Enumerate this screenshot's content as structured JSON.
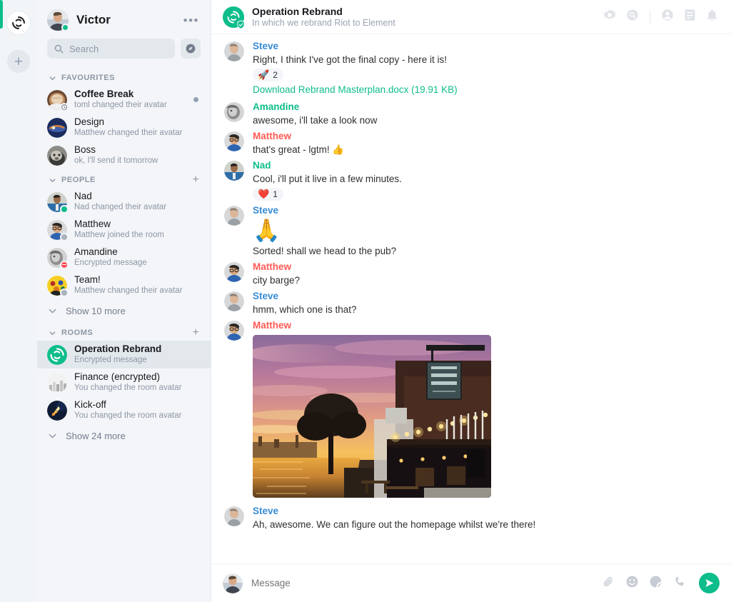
{
  "rail": {
    "home_icon": "element-logo-icon",
    "add_space_label": "+"
  },
  "sidebar": {
    "user": {
      "name": "Victor",
      "presence": "online"
    },
    "options_label": "•••",
    "search": {
      "placeholder": "Search",
      "icon": "search-icon"
    },
    "explore_icon": "compass-icon",
    "sections": [
      {
        "id": "favourites",
        "title": "FAVOURITES",
        "has_add": false,
        "items": [
          {
            "name": "Coffee Break",
            "subtitle": "toml changed their avatar",
            "unread": true,
            "bold": true,
            "badge": "clock",
            "avatar": "coffee"
          },
          {
            "name": "Design",
            "subtitle": "Matthew changed their avatar",
            "unread": false,
            "bold": false,
            "badge": "none",
            "avatar": "design"
          },
          {
            "name": "Boss",
            "subtitle": "ok, I'll send it tomorrow",
            "unread": false,
            "bold": false,
            "badge": "none",
            "avatar": "boss"
          }
        ],
        "show_more": null
      },
      {
        "id": "people",
        "title": "PEOPLE",
        "has_add": true,
        "add_label": "+",
        "items": [
          {
            "name": "Nad",
            "subtitle": "Nad changed their avatar",
            "unread": false,
            "bold": false,
            "badge": "online",
            "avatar": "nad"
          },
          {
            "name": "Matthew",
            "subtitle": "Matthew joined the room",
            "unread": false,
            "bold": false,
            "badge": "offline",
            "avatar": "matthew"
          },
          {
            "name": "Amandine",
            "subtitle": "Encrypted message",
            "unread": false,
            "bold": false,
            "badge": "dnd",
            "avatar": "amandine"
          },
          {
            "name": "Team!",
            "subtitle": "Matthew changed their avatar",
            "unread": false,
            "bold": false,
            "badge": "offline",
            "avatar": "team"
          }
        ],
        "show_more": "Show 10 more"
      },
      {
        "id": "rooms",
        "title": "ROOMS",
        "has_add": true,
        "add_label": "+",
        "items": [
          {
            "name": "Operation Rebrand",
            "subtitle": "Encrypted message",
            "unread": false,
            "bold": true,
            "badge": "none",
            "avatar": "rebrand",
            "selected": true
          },
          {
            "name": "Finance (encrypted)",
            "subtitle": "You changed the room avatar",
            "unread": false,
            "bold": false,
            "badge": "none",
            "avatar": "finance"
          },
          {
            "name": "Kick-off",
            "subtitle": "You changed the room avatar",
            "unread": false,
            "bold": false,
            "badge": "none",
            "avatar": "kickoff"
          }
        ],
        "show_more": "Show 24 more"
      }
    ]
  },
  "room_header": {
    "title": "Operation Rebrand",
    "topic": "In which we rebrand Riot to Element",
    "avatar_icon": "element-logo-icon",
    "encryption_badge": "shield-verified-icon",
    "actions": [
      {
        "name": "room-settings-button",
        "icon": "gear-icon"
      },
      {
        "name": "search-room-button",
        "icon": "search-circle-icon"
      },
      {
        "name": "member-list-button",
        "icon": "person-icon"
      },
      {
        "name": "room-info-button",
        "icon": "notes-icon"
      },
      {
        "name": "notifications-button",
        "icon": "bell-icon"
      }
    ]
  },
  "timeline": {
    "events": [
      {
        "sender": "Steve",
        "sender_class": "steve",
        "avatar": "steve",
        "text": "Right, I think I've got the final copy - here it is!",
        "reaction": {
          "emoji": "🚀",
          "count": "2"
        },
        "link": "Download Rebrand Masterplan.docx (19.91 KB)"
      },
      {
        "sender": "Amandine",
        "sender_class": "amandine",
        "avatar": "amandine",
        "text": "awesome, i'll take a look now"
      },
      {
        "sender": "Matthew",
        "sender_class": "matthew",
        "avatar": "matthew",
        "text": "that's great - lgtm! 👍"
      },
      {
        "sender": "Nad",
        "sender_class": "nad",
        "avatar": "nad",
        "text": "Cool, i'll put it live in a few minutes.",
        "reaction": {
          "emoji": "❤️",
          "count": "1"
        }
      },
      {
        "sender": "Steve",
        "sender_class": "steve",
        "avatar": "steve",
        "big_emoji": "🙏",
        "text": "Sorted! shall we head to the pub?"
      },
      {
        "sender": "Matthew",
        "sender_class": "matthew",
        "avatar": "matthew",
        "text": "city barge?"
      },
      {
        "sender": "Steve",
        "sender_class": "steve",
        "avatar": "steve",
        "text": "hmm, which one is that?"
      },
      {
        "sender": "Matthew",
        "sender_class": "matthew",
        "avatar": "matthew",
        "image": "sunset-riverside-pub-the-city-barge"
      },
      {
        "sender": "Steve",
        "sender_class": "steve",
        "avatar": "steve",
        "text": "Ah, awesome. We can figure out the homepage whilst we're there!"
      }
    ]
  },
  "composer": {
    "placeholder": "Message",
    "buttons": [
      {
        "name": "attach-file-button",
        "icon": "paperclip-icon"
      },
      {
        "name": "emoji-button",
        "icon": "smiley-icon"
      },
      {
        "name": "sticker-button",
        "icon": "sticker-icon"
      },
      {
        "name": "voice-call-button",
        "icon": "phone-icon"
      },
      {
        "name": "send-button",
        "icon": "send-icon"
      }
    ]
  },
  "colors": {
    "accent": "#0dbd8b",
    "sender_blue": "#368bd6",
    "sender_red": "#ff5b55",
    "panel_bg": "#f3f5f8",
    "selected_bg": "#e3e8ed"
  }
}
